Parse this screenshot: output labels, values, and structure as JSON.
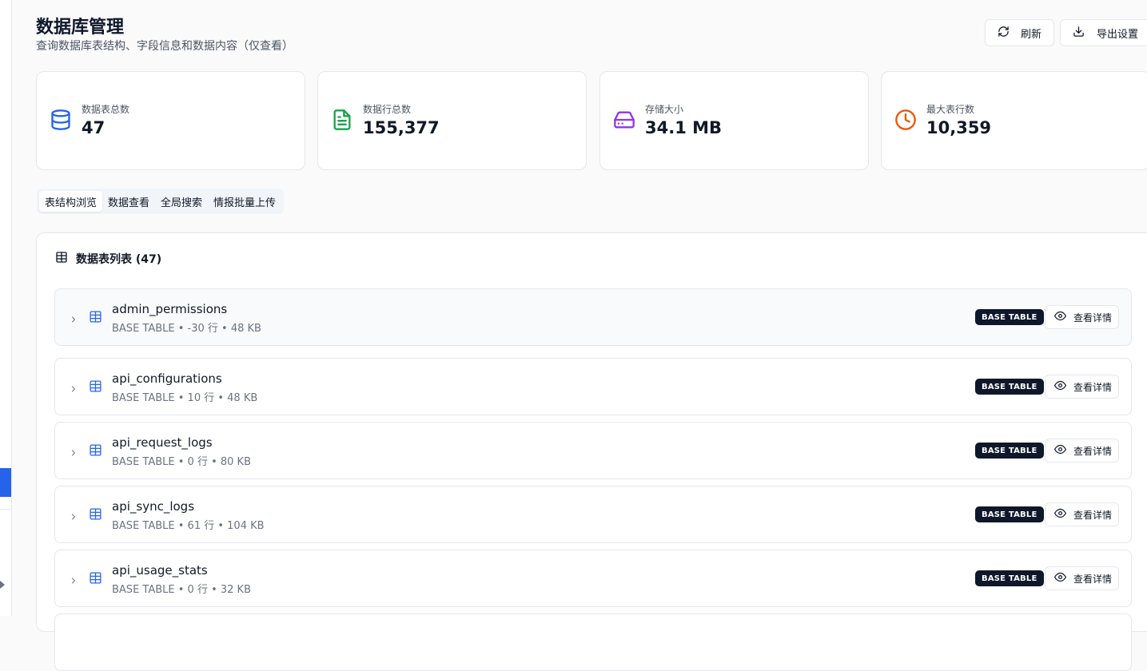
{
  "header": {
    "title": "数据库管理",
    "subtitle": "查询数据库表结构、字段信息和数据内容（仅查看）",
    "refresh_label": "刷新",
    "export_label": "导出设置"
  },
  "stats": [
    {
      "label": "数据表总数",
      "value": "47",
      "icon": "database-icon",
      "color": "#2563eb"
    },
    {
      "label": "数据行总数",
      "value": "155,377",
      "icon": "file-text-icon",
      "color": "#16a34a"
    },
    {
      "label": "存储大小",
      "value": "34.1 MB",
      "icon": "hard-drive-icon",
      "color": "#9333ea"
    },
    {
      "label": "最大表行数",
      "value": "10,359",
      "icon": "clock-icon",
      "color": "#ea580c"
    }
  ],
  "tabs": [
    {
      "label": "表结构浏览",
      "active": true
    },
    {
      "label": "数据查看",
      "active": false
    },
    {
      "label": "全局搜索",
      "active": false
    },
    {
      "label": "情报批量上传",
      "active": false
    }
  ],
  "table_list": {
    "title": "数据表列表 (47)",
    "view_label": "查看详情",
    "rows": [
      {
        "name": "admin_permissions",
        "meta": "BASE TABLE • -30 行 • 48 KB",
        "badge": "BASE TABLE"
      },
      {
        "name": "api_configurations",
        "meta": "BASE TABLE • 10 行 • 48 KB",
        "badge": "BASE TABLE"
      },
      {
        "name": "api_request_logs",
        "meta": "BASE TABLE • 0 行 • 80 KB",
        "badge": "BASE TABLE"
      },
      {
        "name": "api_sync_logs",
        "meta": "BASE TABLE • 61 行 • 104 KB",
        "badge": "BASE TABLE"
      },
      {
        "name": "api_usage_stats",
        "meta": "BASE TABLE • 0 行 • 32 KB",
        "badge": "BASE TABLE"
      }
    ]
  }
}
